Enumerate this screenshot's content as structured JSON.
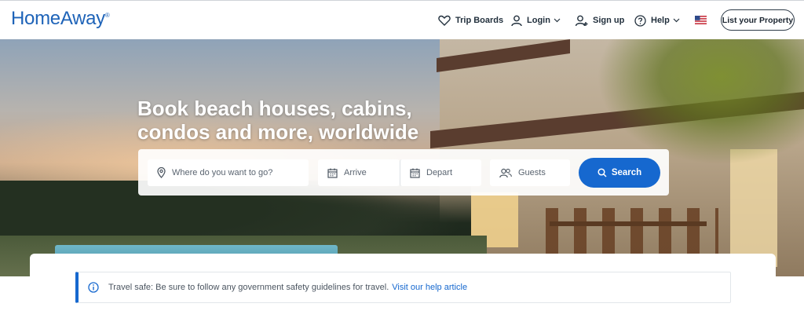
{
  "header": {
    "logo": "HomeAway",
    "nav": {
      "trip_boards": "Trip Boards",
      "login": "Login",
      "signup": "Sign up",
      "help": "Help"
    },
    "list_property": "List your Property"
  },
  "hero": {
    "headline_line1": "Book beach houses, cabins,",
    "headline_line2": "condos and more, worldwide"
  },
  "search": {
    "where_placeholder": "Where do you want to go?",
    "arrive": "Arrive",
    "depart": "Depart",
    "guests": "Guests",
    "button": "Search"
  },
  "notice": {
    "text": "Travel safe: Be sure to follow any government safety guidelines for travel.",
    "link": "Visit our help article"
  },
  "colors": {
    "brand_blue": "#1e63b8",
    "button_blue": "#1668cf"
  }
}
